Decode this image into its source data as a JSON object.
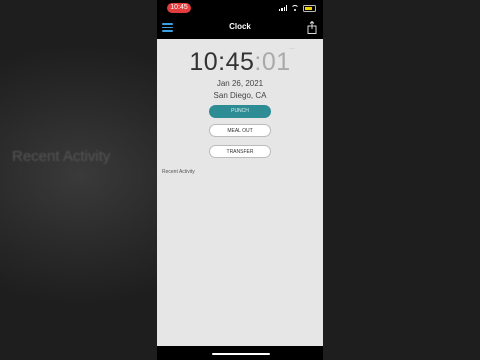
{
  "background": {
    "ghost_text": "Recent Activity"
  },
  "status_bar": {
    "time": "10:45",
    "time_pill_color": "#e23c3c",
    "battery_color": "#f2d200"
  },
  "nav": {
    "title": "Clock",
    "menu_icon": "hamburger-menu-icon",
    "share_icon": "share-icon",
    "accent": "#3aa0e0"
  },
  "clock": {
    "hours_minutes": "10:45",
    "seconds": ":01",
    "corner": "...."
  },
  "date": "Jan 26, 2021",
  "location": "San Diego, CA",
  "buttons": {
    "punch": "PUNCH",
    "meal_out": "MEAL OUT",
    "transfer": "TRANSFER",
    "punch_color": "#2e8c95"
  },
  "recent_activity": {
    "label": "Recent Activity"
  }
}
